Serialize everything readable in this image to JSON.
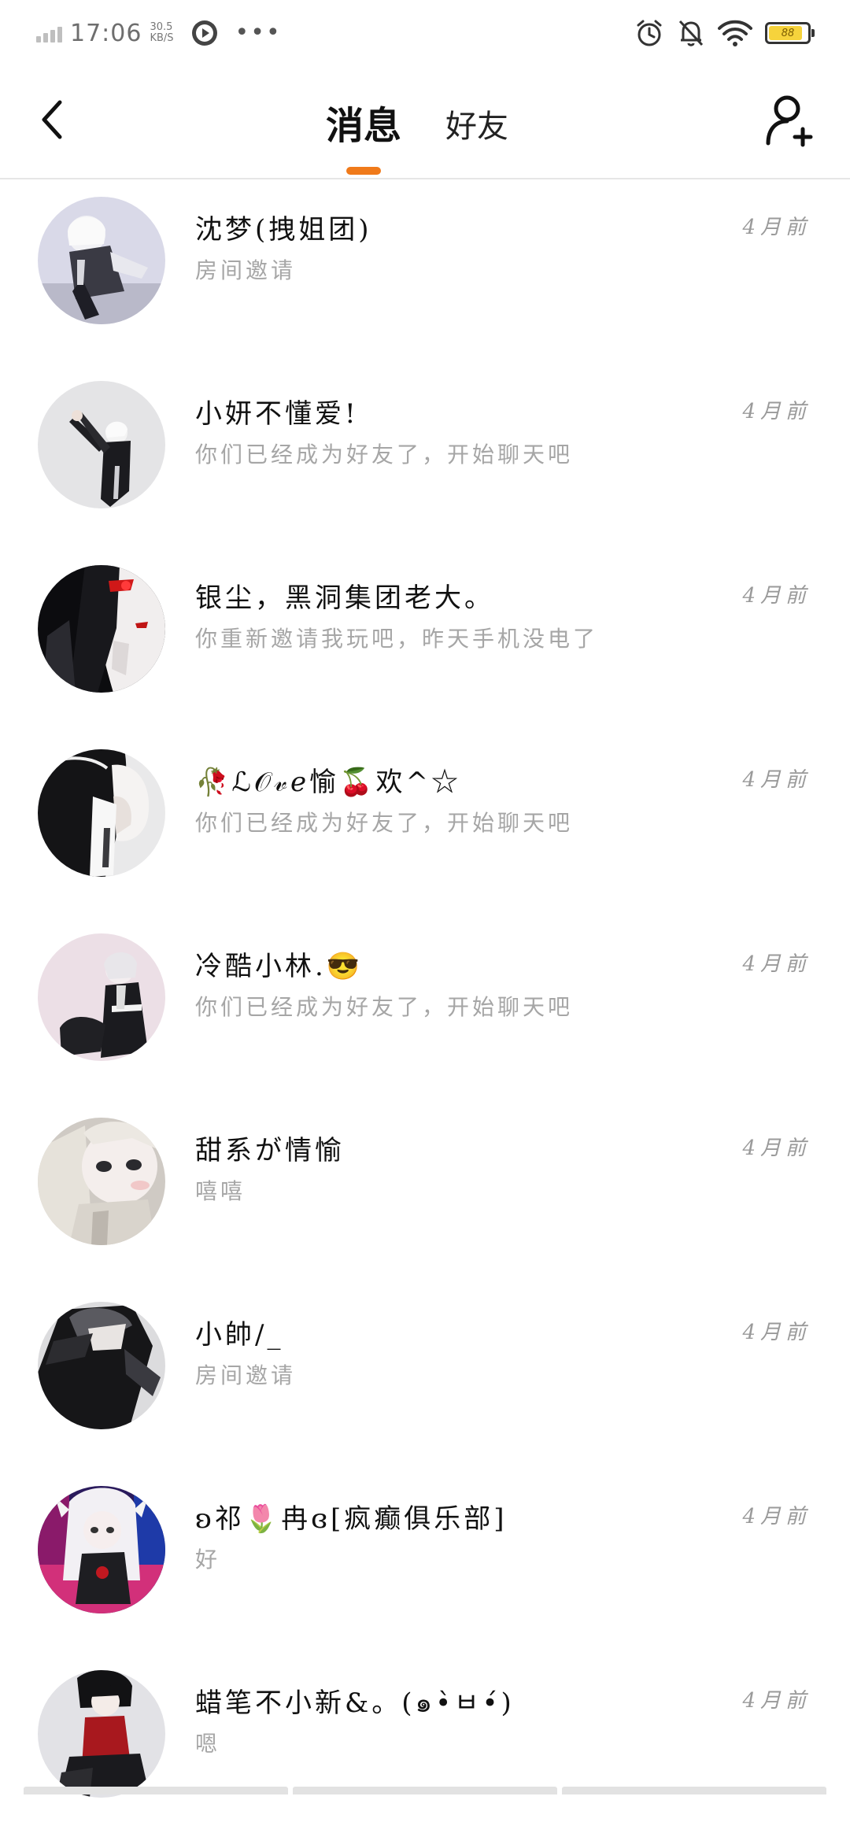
{
  "status_bar": {
    "time": "17:06",
    "net_speed_value": "30.5",
    "net_speed_unit": "KB/S",
    "more_dots": "•••",
    "battery_level": "88"
  },
  "header": {
    "tabs": [
      {
        "label": "消息",
        "active": true
      },
      {
        "label": "好友",
        "active": false
      }
    ],
    "accent_color": "#f07a1a"
  },
  "conversations": [
    {
      "name": "沈梦(拽姐团)",
      "preview": "房间邀请",
      "time": "4月前",
      "avatar_icon": "anime-avatar-white-hair-crouching"
    },
    {
      "name": "小妍不懂爱!",
      "preview": "你们已经成为好友了，开始聊天吧",
      "time": "4月前",
      "avatar_icon": "anime-avatar-white-hair-black-outfit"
    },
    {
      "name": "银尘，黑洞集团老大。",
      "preview": "你重新邀请我玩吧，昨天手机没电了",
      "time": "4月前",
      "avatar_icon": "anime-avatar-red-eyes-dark"
    },
    {
      "name": "🥀ℒ𝒪𝓋ℯ愉🍒欢^☆",
      "preview": "你们已经成为好友了，开始聊天吧",
      "time": "4月前",
      "avatar_icon": "anime-avatar-black-hair-braid"
    },
    {
      "name": "冷酷小林.😎",
      "preview": "你们已经成为好友了，开始聊天吧",
      "time": "4月前",
      "avatar_icon": "anime-avatar-silver-hair-jacket"
    },
    {
      "name": "甜系が情愉",
      "preview": "嘻嘻",
      "time": "4月前",
      "avatar_icon": "anime-avatar-pale-face-closeup"
    },
    {
      "name": "小帥/_",
      "preview": "房间邀请",
      "time": "4月前",
      "avatar_icon": "anime-avatar-dark-hood"
    },
    {
      "name": "ʚ祁🌷冉ɞ[疯癫俱乐部]",
      "preview": "好",
      "time": "4月前",
      "avatar_icon": "anime-avatar-white-hair-neon"
    },
    {
      "name": "蜡笔不小新&。(๑•̀ㅂ•́)",
      "preview": "嗯",
      "time": "4月前",
      "avatar_icon": "anime-avatar-black-hair-red-shirt"
    }
  ]
}
